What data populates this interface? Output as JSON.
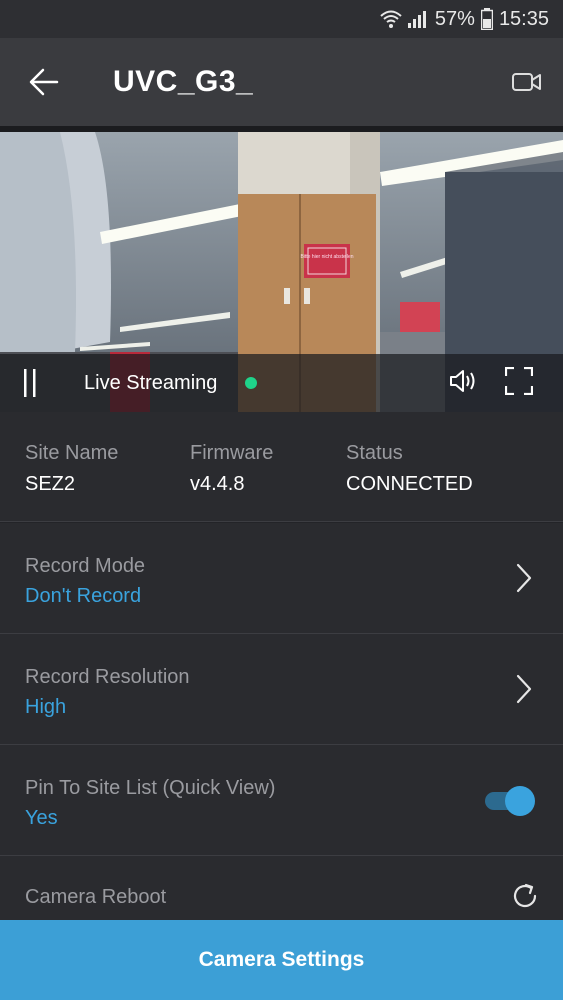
{
  "status_bar": {
    "battery": "57%",
    "time": "15:35",
    "icons": [
      "wifi-icon",
      "signal-icon",
      "battery-icon"
    ]
  },
  "header": {
    "title": "UVC_G3_",
    "back_icon": "arrow-left-icon",
    "video_icon": "video-camera-icon"
  },
  "video": {
    "sign_text": "Bitte hier nicht abstellen",
    "controls": {
      "pause_icon": "pause-icon",
      "live_label": "Live Streaming",
      "live_color": "#1fd38a",
      "sound_icon": "speaker-icon",
      "fullscreen_icon": "fullscreen-icon"
    }
  },
  "info": {
    "site_name_label": "Site Name",
    "site_name_value": "SEZ2",
    "firmware_label": "Firmware",
    "firmware_value": "v4.4.8",
    "status_label": "Status",
    "status_value": "CONNECTED"
  },
  "settings": [
    {
      "title": "Record Mode",
      "value": "Don't Record",
      "control": "chevron-right-icon"
    },
    {
      "title": "Record Resolution",
      "value": "High",
      "control": "chevron-right-icon"
    },
    {
      "title": "Pin To Site List (Quick View)",
      "value": "Yes",
      "control": "toggle",
      "toggle_on": true
    }
  ],
  "reboot": {
    "title": "Camera Reboot",
    "icon": "refresh-icon"
  },
  "footer": {
    "button_label": "Camera Settings"
  },
  "colors": {
    "accent": "#3aa3de",
    "button_bg": "#3c9fd6",
    "background": "#232428",
    "panel": "#2a2b2f"
  }
}
